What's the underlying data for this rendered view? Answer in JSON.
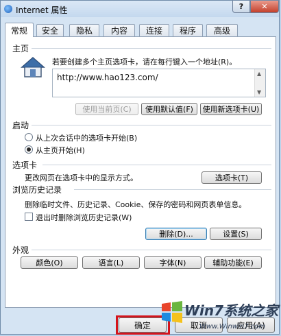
{
  "window": {
    "title": "Internet 属性",
    "help_label": "?",
    "close_label": "✕"
  },
  "tabs": [
    {
      "label": "常规"
    },
    {
      "label": "安全"
    },
    {
      "label": "隐私"
    },
    {
      "label": "内容"
    },
    {
      "label": "连接"
    },
    {
      "label": "程序"
    },
    {
      "label": "高级"
    }
  ],
  "home": {
    "section": "主页",
    "instruction": "若要创建多个主页选项卡，请在每行键入一个地址(R)。",
    "url": "http://www.hao123.com/",
    "use_current": "使用当前页(C)",
    "use_default": "使用默认值(F)",
    "use_new_tab": "使用新选项卡(U)"
  },
  "startup": {
    "section": "启动",
    "option_last": "从上次会话中的选项卡开始(B)",
    "option_home": "从主页开始(H)"
  },
  "tabs_section": {
    "section": "选项卡",
    "desc": "更改网页在选项卡中的显示方式。",
    "button": "选项卡(T)"
  },
  "history": {
    "section": "浏览历史记录",
    "desc": "删除临时文件、历史记录、Cookie、保存的密码和网页表单信息。",
    "checkbox": "退出时删除浏览历史记录(W)",
    "delete": "删除(D)...",
    "settings": "设置(S)"
  },
  "appearance": {
    "section": "外观",
    "colors": "颜色(O)",
    "languages": "语言(L)",
    "fonts": "字体(N)",
    "accessibility": "辅助功能(E)"
  },
  "footer": {
    "ok": "确定",
    "cancel": "取消",
    "apply": "应用(A)"
  },
  "watermark": {
    "brand": "Win7系统之家",
    "url": "Www.Winwin7.com"
  }
}
